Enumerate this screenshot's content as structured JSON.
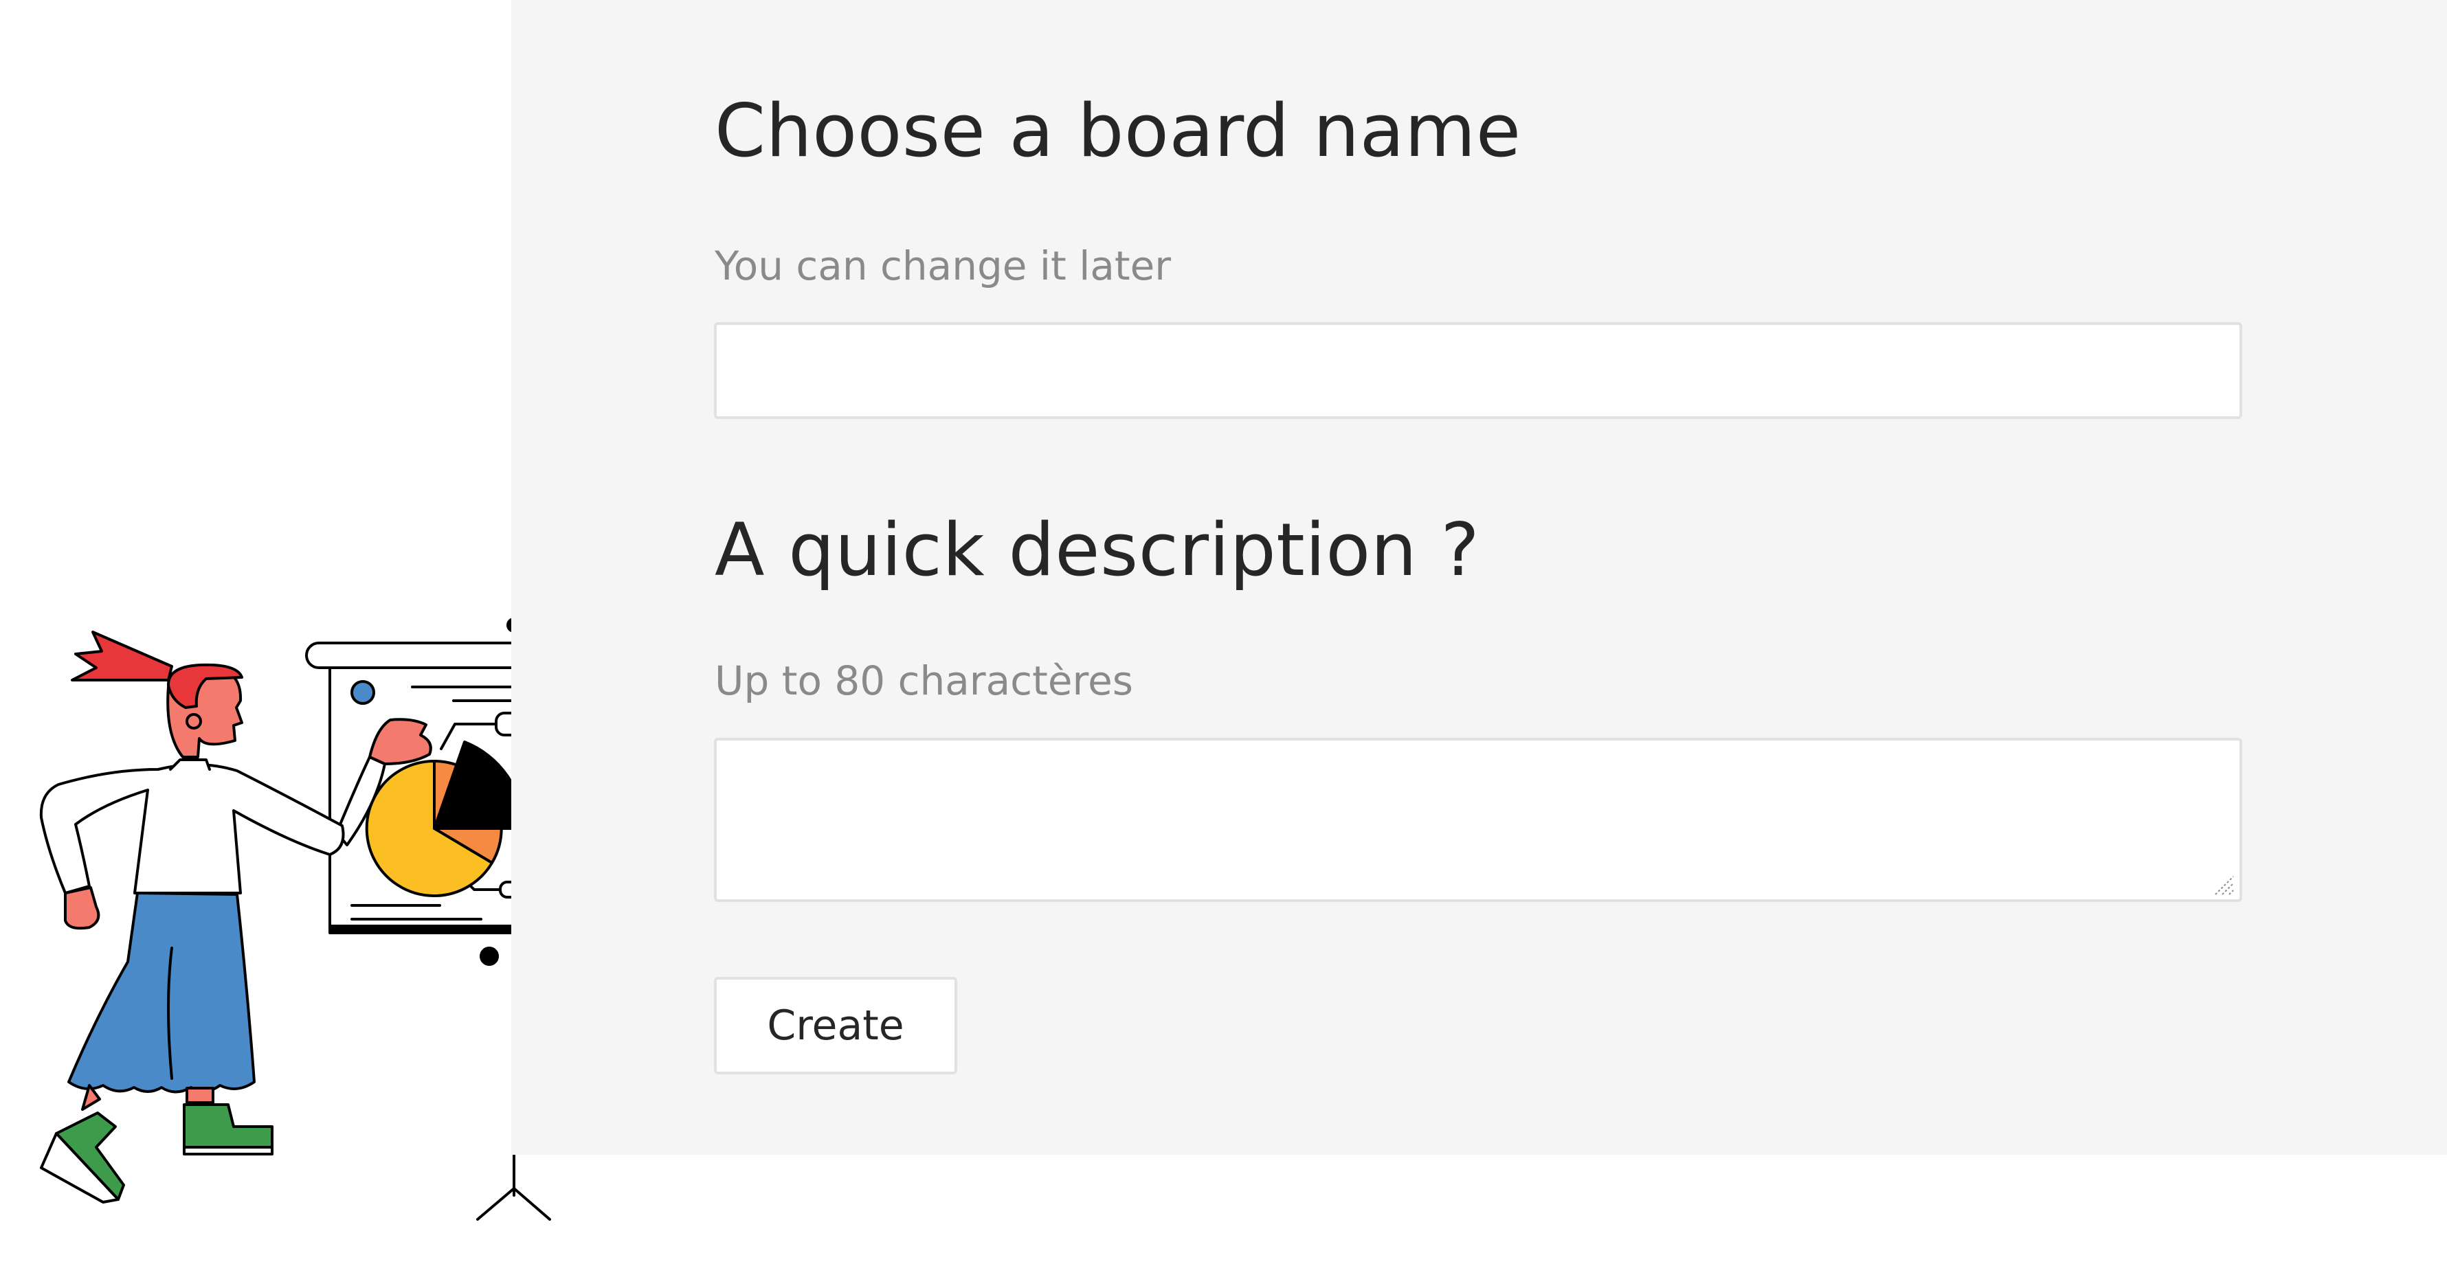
{
  "form": {
    "board_name": {
      "heading": "Choose a board name",
      "hint": "You can change it later",
      "value": "",
      "placeholder": ""
    },
    "description": {
      "heading": "A quick description ?",
      "hint": "Up to 80 charactères",
      "value": "",
      "placeholder": ""
    },
    "create_label": "Create"
  },
  "illustration": {
    "name": "presenter-with-pie-chart-illustration",
    "colors": {
      "hair": "#e8373a",
      "skin": "#f37a6c",
      "shirt": "#ffffff",
      "skirt": "#4a8ac8",
      "shoes": "#3e9b4b",
      "pie_yellow": "#fbbf24",
      "pie_orange": "#f58a43",
      "pie_black": "#000000",
      "dot_blue": "#4a8ac8"
    }
  },
  "colors": {
    "panel_background": "#f5f5f5",
    "heading_text": "#262626",
    "hint_text": "#8a8a8a",
    "input_border": "#e1e1e1"
  }
}
